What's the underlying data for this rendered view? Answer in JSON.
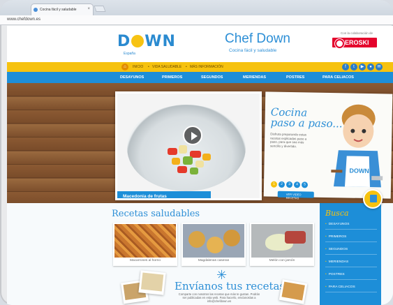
{
  "browser": {
    "tab_title": "Cocina fácil y saludable",
    "tab_close": "×",
    "url": "www.chefdown.es"
  },
  "header": {
    "logo_text": "D",
    "logo_text2": "WN",
    "logo_sub": "España",
    "title": "Chef Down",
    "subtitle": "Cocina fácil y saludable",
    "collab": "Con la colaboración de",
    "sponsor": "EROSKI"
  },
  "topbar": {
    "links": [
      "INICIO",
      "VIDA SALUDABLE",
      "MÁS INFORMACIÓN"
    ],
    "social_icons": [
      "facebook-icon",
      "twitter-icon",
      "youtube-icon",
      "flickr-icon",
      "mail-icon"
    ]
  },
  "nav": {
    "items": [
      "DESAYUNOS",
      "PRIMEROS",
      "SEGUNDOS",
      "MERIENDAS",
      "POSTRES",
      "PARA CELIACOS"
    ]
  },
  "hero": {
    "caption": "Macedonia de frutas",
    "side_title_1": "Cocina",
    "side_title_2": "paso a paso...",
    "side_desc": "Disfruta preparando estas recetas explicadas paso a paso, para que sea más sencillo y divertido.",
    "steps": [
      "1",
      "2",
      "3",
      "4",
      "5"
    ],
    "all_button": "VER VIDEO RECETAS"
  },
  "recipes": {
    "title": "Recetas saludables",
    "items": [
      {
        "label": "Macarrones al horno"
      },
      {
        "label": "Magdalenas caseras"
      },
      {
        "label": "Melón con jamón"
      }
    ]
  },
  "send": {
    "title": "Envíanos tus recetas",
    "subtitle": "Comparte con nosotros las recetas que más te gustan. Podrán ser publicadas en esta web. Para hacerlo, envíanoslas a info@chefdown.es"
  },
  "sidebar": {
    "title": "Busca",
    "items": [
      "DESAYUNOS",
      "PRIMEROS",
      "SEGUNDOS",
      "MERIENDAS",
      "POSTRES",
      "PARA CELIACOS"
    ]
  },
  "colors": {
    "brand_blue": "#1d8ed8",
    "brand_yellow": "#f6c20f",
    "sponsor_red": "#e4032c"
  }
}
